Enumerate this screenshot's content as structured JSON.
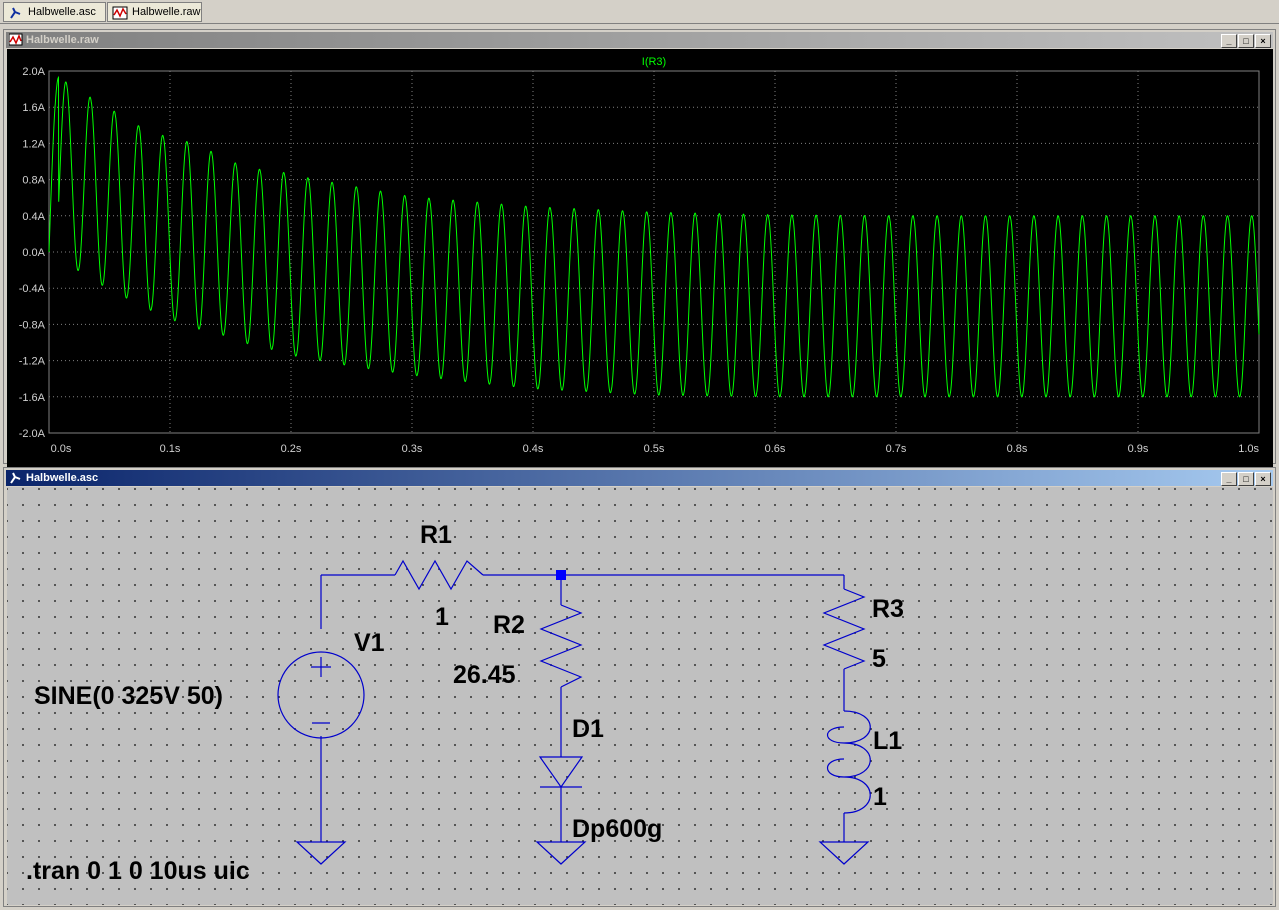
{
  "tabs": [
    {
      "label": "Halbwelle.asc"
    },
    {
      "label": "Halbwelle.raw"
    }
  ],
  "waveform_window": {
    "title": "Halbwelle.raw",
    "trace_label": "I(R3)",
    "trace_color": "#00ff00",
    "grid_color": "#808080",
    "y_ticks": [
      "2.0A",
      "1.6A",
      "1.2A",
      "0.8A",
      "0.4A",
      "0.0A",
      "-0.4A",
      "-0.8A",
      "-1.2A",
      "-1.6A",
      "-2.0A"
    ],
    "x_ticks": [
      "0.0s",
      "0.1s",
      "0.2s",
      "0.3s",
      "0.4s",
      "0.5s",
      "0.6s",
      "0.7s",
      "0.8s",
      "0.9s",
      "1.0s"
    ]
  },
  "chart_data": {
    "type": "line",
    "title": "I(R3)",
    "xlabel": "",
    "ylabel": "",
    "xlim": [
      0,
      1.0
    ],
    "ylim": [
      -2.0,
      2.0
    ],
    "grid": true,
    "series": [
      {
        "name": "I(R3)",
        "description_points": {
          "frequency_hz": 50,
          "max_envelope_x": [
            0.008,
            0.03,
            0.05,
            0.07,
            0.09,
            0.11,
            0.13,
            0.15,
            0.17,
            0.19,
            0.21,
            0.25,
            0.3,
            0.4,
            0.5,
            0.6,
            0.7,
            0.8,
            0.9,
            1.0
          ],
          "max_envelope_y": [
            1.93,
            1.74,
            1.59,
            1.42,
            1.3,
            1.24,
            1.14,
            1.0,
            0.92,
            0.89,
            0.83,
            0.73,
            0.61,
            0.5,
            0.44,
            0.41,
            0.4,
            0.4,
            0.4,
            0.4
          ],
          "min_envelope_x": [
            0.02,
            0.04,
            0.06,
            0.08,
            0.1,
            0.12,
            0.14,
            0.16,
            0.18,
            0.2,
            0.24,
            0.3,
            0.35,
            0.4,
            0.5,
            0.6,
            0.7,
            0.8,
            0.9,
            1.0
          ],
          "min_envelope_y": [
            -0.17,
            -0.34,
            -0.48,
            -0.62,
            -0.74,
            -0.84,
            -0.9,
            -1.0,
            -1.06,
            -1.14,
            -1.24,
            -1.36,
            -1.44,
            -1.51,
            -1.58,
            -1.6,
            -1.6,
            -1.6,
            -1.6,
            -1.6
          ]
        }
      }
    ]
  },
  "schematic_window": {
    "title": "Halbwelle.asc",
    "wire_color": "#0000cc",
    "components": {
      "r1": {
        "name": "R1",
        "value": "1"
      },
      "r2": {
        "name": "R2",
        "value": "26.45"
      },
      "r3": {
        "name": "R3",
        "value": "5"
      },
      "d1": {
        "name": "D1",
        "value": "Dp600g"
      },
      "l1": {
        "name": "L1",
        "value": "1"
      },
      "v1": {
        "name": "V1",
        "value": "SINE(0 325V 50)"
      }
    },
    "directive": ".tran 0 1 0 10us uic"
  }
}
